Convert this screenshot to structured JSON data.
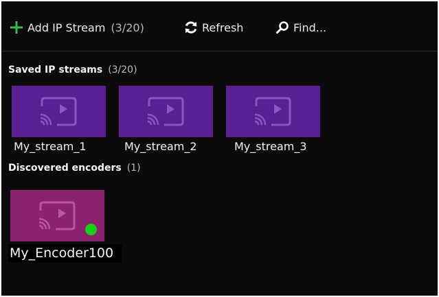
{
  "toolbar": {
    "add_label": "Add IP Stream",
    "add_count": "(3/20)",
    "refresh_label": "Refresh",
    "find_label": "Find..."
  },
  "saved": {
    "title": "Saved IP streams",
    "count": "(3/20)",
    "items": [
      {
        "label": "My_stream_1",
        "icon": "cast-screen-icon"
      },
      {
        "label": "My_stream_2",
        "icon": "cast-screen-icon"
      },
      {
        "label": "My_stream_3",
        "icon": "cast-screen-icon"
      }
    ]
  },
  "discovered": {
    "title": "Discovered encoders",
    "count": "(1)",
    "items": [
      {
        "label": "My_Encoder100",
        "icon": "cast-screen-icon",
        "status": "online"
      }
    ]
  },
  "colors": {
    "background": "#0b0b0b",
    "stream_tile": "#5b1f94",
    "encoder_tile": "#8a2171",
    "status_online": "#13d213",
    "add_icon": "#35c24a"
  }
}
